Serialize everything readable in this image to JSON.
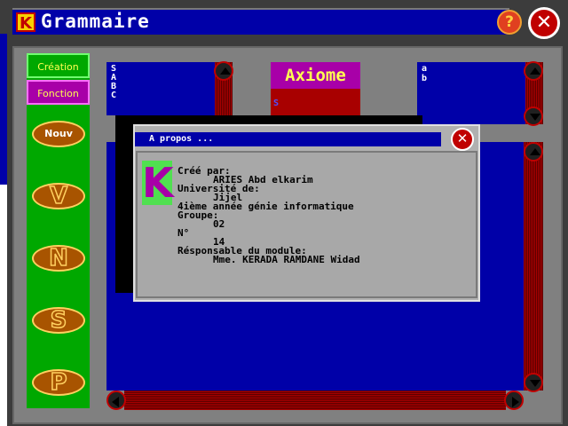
{
  "app": {
    "logo_letter": "K",
    "title": "Grammaire",
    "help_icon": "?",
    "close_icon": "✕"
  },
  "toolbar": {
    "tabs": [
      "Création",
      "Fonction"
    ],
    "buttons": [
      "Nouv",
      "V",
      "N",
      "S",
      "P"
    ]
  },
  "panels": {
    "nonterminals": [
      "S",
      "A",
      "B",
      "C"
    ],
    "axiome_label": "Axiome",
    "axiome_value": "S",
    "terminals": [
      "a",
      "b"
    ]
  },
  "about": {
    "title": "A propos ...",
    "logo_letter": "K",
    "lines": [
      "Créé par:",
      "ARIES Abd elkarim",
      "Université de:",
      "Jijel",
      "4ième année génie informatique",
      "Groupe:",
      "02",
      "N°",
      "14",
      "Résponsable du module:",
      "Mme. KERADA RAMDANE Widad"
    ]
  },
  "colors": {
    "panel_blue": "#0000a8",
    "toolbar_green": "#00a800",
    "accent_magenta": "#a800a8",
    "scroll_red": "#a80000"
  }
}
